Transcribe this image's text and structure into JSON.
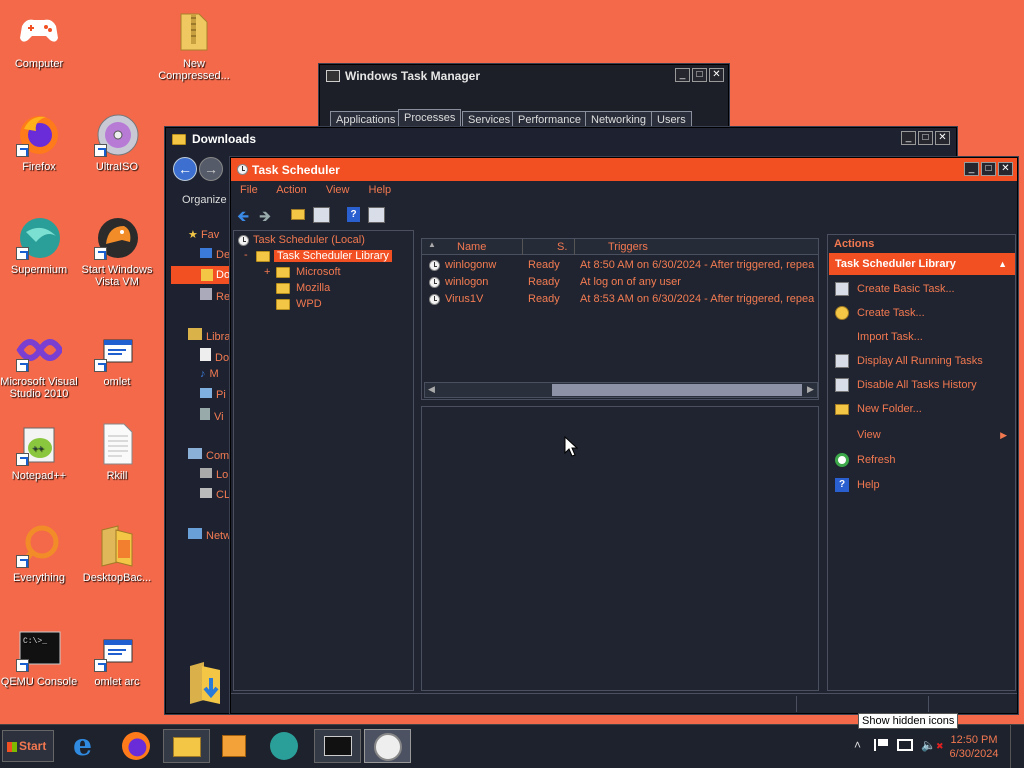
{
  "desktop": {
    "icons": [
      {
        "label": "Computer",
        "icon": "gamepad-icon"
      },
      {
        "label": "New Compressed...",
        "icon": "zip-folder-icon"
      },
      {
        "label": "Firefox",
        "icon": "firefox-icon"
      },
      {
        "label": "UltraISO",
        "icon": "disc-icon"
      },
      {
        "label": "Supermium",
        "icon": "supermium-icon"
      },
      {
        "label": "Start Windows Vista VM",
        "icon": "qemu-bird-icon"
      },
      {
        "label": "Microsoft Visual Studio 2010",
        "icon": "visual-studio-icon"
      },
      {
        "label": "omlet",
        "icon": "omlet-icon"
      },
      {
        "label": "Notepad++",
        "icon": "notepad-plus-plus-icon"
      },
      {
        "label": "Rkill",
        "icon": "document-icon"
      },
      {
        "label": "Everything",
        "icon": "everything-search-icon"
      },
      {
        "label": "DesktopBac...",
        "icon": "folder-icon"
      },
      {
        "label": "QEMU Console",
        "icon": "console-icon"
      },
      {
        "label": "omlet arc",
        "icon": "omlet-icon"
      }
    ]
  },
  "task_manager": {
    "title": "Windows Task Manager",
    "tabs": [
      "Applications",
      "Processes",
      "Services",
      "Performance",
      "Networking",
      "Users"
    ]
  },
  "downloads": {
    "title": "Downloads",
    "organize": "Organize",
    "nav": [
      {
        "label": "Fav",
        "icon": "star-icon"
      },
      {
        "label": "De",
        "icon": "desktop-icon"
      },
      {
        "label": "Do",
        "icon": "downloads-icon"
      },
      {
        "label": "Re",
        "icon": "recent-icon"
      },
      {
        "label": "Libra",
        "icon": "library-icon"
      },
      {
        "label": "Do",
        "icon": "documents-icon"
      },
      {
        "label": "M",
        "icon": "music-icon"
      },
      {
        "label": "Pi",
        "icon": "pictures-icon"
      },
      {
        "label": "Vi",
        "icon": "videos-icon"
      },
      {
        "label": "Com",
        "icon": "computer-icon"
      },
      {
        "label": "Lo",
        "icon": "drive-icon"
      },
      {
        "label": "CL",
        "icon": "network-drive-icon"
      },
      {
        "label": "Netw",
        "icon": "network-icon"
      }
    ]
  },
  "scheduler": {
    "title": "Task Scheduler",
    "menu": [
      "File",
      "Action",
      "View",
      "Help"
    ],
    "tree": {
      "root": "Task Scheduler (Local)",
      "library": "Task Scheduler Library",
      "expand_minus": "-",
      "expand_plus": "+",
      "children": [
        "Microsoft",
        "Mozilla",
        "WPD"
      ]
    },
    "columns": [
      "Name",
      "S.",
      "Triggers"
    ],
    "tasks": [
      {
        "name": "winlogonw",
        "status": "Ready",
        "trigger": "At 8:50 AM on 6/30/2024 - After triggered, repea"
      },
      {
        "name": "winlogon",
        "status": "Ready",
        "trigger": "At log on of any user"
      },
      {
        "name": "Virus1V",
        "status": "Ready",
        "trigger": "At 8:53 AM on 6/30/2024 - After triggered, repea"
      }
    ],
    "actions_header": "Actions",
    "actions_section": "Task Scheduler Library",
    "actions": [
      {
        "label": "Create Basic Task...",
        "icon": "create-basic-task-icon"
      },
      {
        "label": "Create Task...",
        "icon": "create-task-icon"
      },
      {
        "label": "Import Task...",
        "icon": ""
      },
      {
        "label": "Display All Running Tasks",
        "icon": "running-tasks-icon"
      },
      {
        "label": "Disable All Tasks History",
        "icon": "history-icon"
      },
      {
        "label": "New Folder...",
        "icon": "folder-icon"
      },
      {
        "label": "View",
        "icon": ""
      },
      {
        "label": "Refresh",
        "icon": "refresh-icon"
      },
      {
        "label": "Help",
        "icon": "help-icon"
      }
    ]
  },
  "taskbar": {
    "start_label": "Start",
    "pinned": [
      "internet-explorer-icon",
      "firefox-icon",
      "explorer-icon",
      "media-player-icon",
      "supermium-icon",
      "task-manager-icon",
      "task-scheduler-icon"
    ],
    "tray_tooltip": "Show hidden icons",
    "time": "12:50 PM",
    "date": "6/30/2024"
  },
  "colors": {
    "accent": "#f25022",
    "desktop": "#f4694a",
    "window": "#1f2430"
  }
}
